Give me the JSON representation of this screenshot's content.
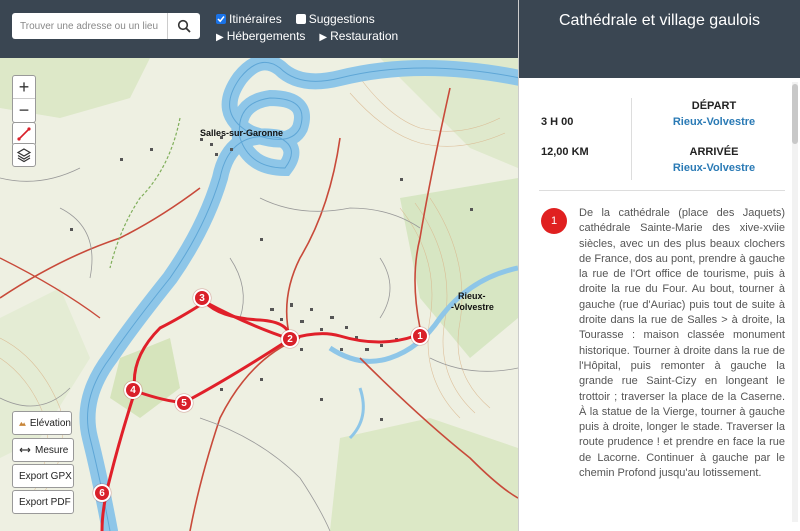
{
  "search": {
    "placeholder": "Trouver une adresse ou un lieu"
  },
  "filters": {
    "itineraires": "Itinéraires",
    "suggestions": "Suggestions",
    "hebergements": "Hébergements",
    "restauration": "Restauration"
  },
  "map": {
    "zoom_in": "+",
    "zoom_out": "−",
    "labels": {
      "salles": "Salles-sur-Garonne",
      "rieux": "Rieux-",
      "volvestre": "-Volvestre"
    },
    "markers": [
      "1",
      "2",
      "3",
      "4",
      "5",
      "6"
    ],
    "buttons": {
      "elevation": "Elévation",
      "mesure": "Mesure",
      "gpx": "Export GPX",
      "pdf": "Export PDF"
    }
  },
  "panel": {
    "title": "Cathédrale et village gaulois",
    "duration": "3 H 00",
    "distance": "12,00 KM",
    "depart_label": "DÉPART",
    "depart_value": "Rieux-Volvestre",
    "arrivee_label": "ARRIVÉE",
    "arrivee_value": "Rieux-Volvestre",
    "step_number": "1",
    "step_text": "De la cathédrale (place des Jaquets) cathédrale Sainte-Marie des xive-xviie siècles, avec un des plus beaux clochers de France, dos au pont, prendre à gauche la rue de l'Ort office de tourisme, puis à droite la rue du Four. Au bout, tourner à gauche (rue d'Auriac) puis tout de suite à droite dans la rue de Salles > à droite, la Tourasse : maison classée monument historique. Tourner à droite dans la rue de l'Hôpital, puis remonter à gauche la grande rue Saint-Cizy en longeant le trottoir ; traverser la place de la Caserne. À la statue de la Vierge, tourner à gauche puis à droite, longer le stade. Traverser la route prudence ! et prendre en face la rue de Lacorne. Continuer à gauche par le chemin Profond jusqu'au lotissement."
  },
  "colors": {
    "header": "#3a4652",
    "route": "#e0202a",
    "accent": "#2a7ab5",
    "river": "#8ec6e8"
  }
}
